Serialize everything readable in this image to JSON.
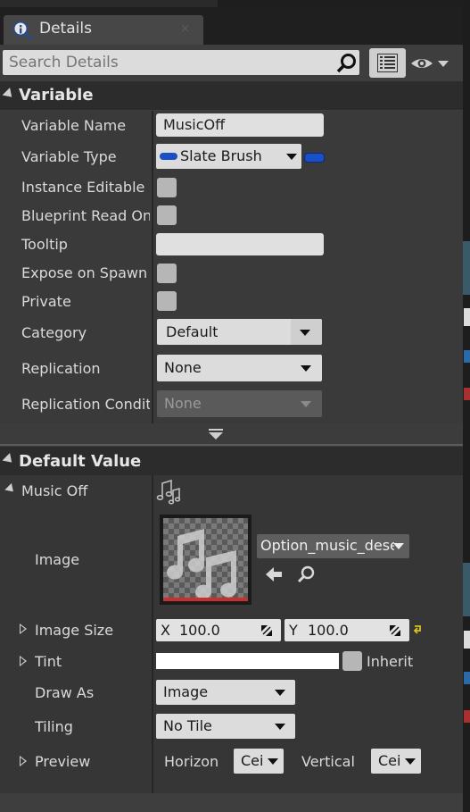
{
  "tab": {
    "title": "Details",
    "close_glyph": "×",
    "icon": "details-magnifier-icon"
  },
  "search": {
    "placeholder": "Search Details",
    "value": ""
  },
  "categories": {
    "variable": "Variable",
    "default_value": "Default Value"
  },
  "variable": {
    "name_label": "Variable Name",
    "name_value": "MusicOff",
    "type_label": "Variable Type",
    "type_value": "Slate Brush",
    "instance_editable_label": "Instance Editable",
    "blueprint_read_only_label": "Blueprint Read Onl",
    "tooltip_label": "Tooltip",
    "tooltip_value": "",
    "expose_on_spawn_label": "Expose on Spawn",
    "private_label": "Private",
    "category_label": "Category",
    "category_value": "Default",
    "replication_label": "Replication",
    "replication_value": "None",
    "replication_condition_label": "Replication Conditi",
    "replication_condition_value": "None"
  },
  "default_value": {
    "struct_label": "Music Off",
    "image_label": "Image",
    "image_asset": "Option_music_dese",
    "image_size_label": "Image Size",
    "image_size_x_label": "X",
    "image_size_x": "100.0",
    "image_size_y_label": "Y",
    "image_size_y": "100.0",
    "tint_label": "Tint",
    "tint_color": "#ffffff",
    "inherit_label": "Inherit",
    "draw_as_label": "Draw As",
    "draw_as_value": "Image",
    "tiling_label": "Tiling",
    "tiling_value": "No Tile",
    "preview_label": "Preview",
    "horizontal_label": "Horizon",
    "horizontal_value": "Cei",
    "vertical_label": "Vertical",
    "vertical_value": "Cei"
  },
  "colors": {
    "panel_bg": "#3e3e3e",
    "header_bg": "#2c2c2c",
    "pin_blue": "#1b4fc4",
    "texture_underline": "#c83030",
    "reset_arrow": "#d8c020"
  }
}
